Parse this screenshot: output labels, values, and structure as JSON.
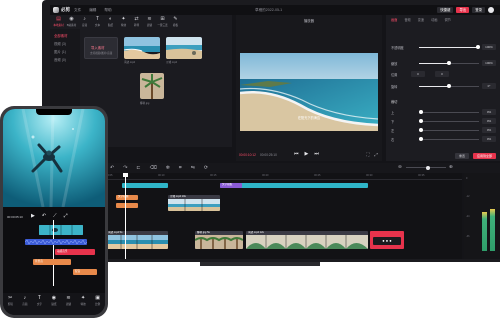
{
  "app": {
    "logo_text": "必剪",
    "menu": [
      "文件",
      "编辑",
      "帮助"
    ],
    "doc_title": "草稿的2022-05-1",
    "export_label": "导出",
    "login_label": "快捷键",
    "account_label": "登录"
  },
  "media_toolbar": {
    "items": [
      {
        "icon": "▤",
        "label": "本地素材",
        "active": true
      },
      {
        "icon": "◉",
        "label": "B站素材"
      },
      {
        "icon": "♪",
        "label": "音频"
      },
      {
        "icon": "T",
        "label": "文本"
      },
      {
        "icon": "◐",
        "label": "贴纸"
      },
      {
        "icon": "✦",
        "label": "特效"
      },
      {
        "icon": "⇄",
        "label": "转场"
      },
      {
        "icon": "≋",
        "label": "滤镜"
      },
      {
        "icon": "⊞",
        "label": "一键三连"
      },
      {
        "icon": "✎",
        "label": "模板"
      }
    ]
  },
  "left_nav": {
    "items": [
      "全部素材",
      "视频 (3)",
      "图片 (1)",
      "音频 (0)"
    ]
  },
  "media": {
    "import_label": "导入素材",
    "import_sub": "支持视频/图片/音频",
    "thumbs": [
      {
        "caption": "海边.mp4"
      },
      {
        "caption": "沙滩.mp4"
      },
      {
        "caption": "椰树.jpg"
      }
    ]
  },
  "player": {
    "title": "播放器",
    "subtitle": "在阳光下的海边",
    "time_current": "00:00:10:12",
    "time_total": "00:00:25:10"
  },
  "props": {
    "tabs": [
      "画面",
      "音频",
      "变速",
      "动画",
      "调节"
    ],
    "rows": [
      {
        "label": "不透明度",
        "value": "100%",
        "fill": 1.0
      },
      {
        "label": "缩放",
        "value": "100%",
        "fill": 0.5
      },
      {
        "label": "位置",
        "value": "0",
        "value2": "0"
      },
      {
        "label": "旋转",
        "value": "0°",
        "fill": 0.5
      }
    ],
    "crop_title": "裁切",
    "crop_rows": [
      {
        "label": "上",
        "value": "0%"
      },
      {
        "label": "下",
        "value": "0%"
      },
      {
        "label": "左",
        "value": "0%"
      },
      {
        "label": "右",
        "value": "0%"
      }
    ],
    "reset_label": "重置",
    "apply_label": "应用到全部"
  },
  "timeline": {
    "ruler_labels": [
      "00:00",
      "00:05",
      "00:10",
      "00:15",
      "00:20",
      "00:25",
      "00:30",
      "00:35"
    ],
    "clips": {
      "title1": "文字模板",
      "title2": "文字标题",
      "video1": "沙滩.mp4 10s",
      "video2": "海边.mp4 5s",
      "video3": "椰树.jpg 5s",
      "video4": "海边.mp4 12s"
    },
    "meter_labels": [
      "0",
      "-12",
      "-24",
      "-36"
    ],
    "meter_levels": [
      0.55,
      0.6
    ]
  },
  "phone": {
    "time": "00:00:05:10",
    "tracks": [
      "动感音乐",
      "背景音",
      "配音"
    ],
    "bottom_tools": [
      {
        "icon": "✂",
        "label": "剪辑"
      },
      {
        "icon": "♪",
        "label": "音频"
      },
      {
        "icon": "T",
        "label": "文字"
      },
      {
        "icon": "◉",
        "label": "贴纸"
      },
      {
        "icon": "≋",
        "label": "滤镜"
      },
      {
        "icon": "✦",
        "label": "特效"
      },
      {
        "icon": "▣",
        "label": "比例"
      }
    ]
  },
  "colors": {
    "accent": "#ff4d6a",
    "clip_teal": "#2fb5c8",
    "clip_orange": "#e8894a",
    "clip_purple": "#8a5bd6"
  }
}
